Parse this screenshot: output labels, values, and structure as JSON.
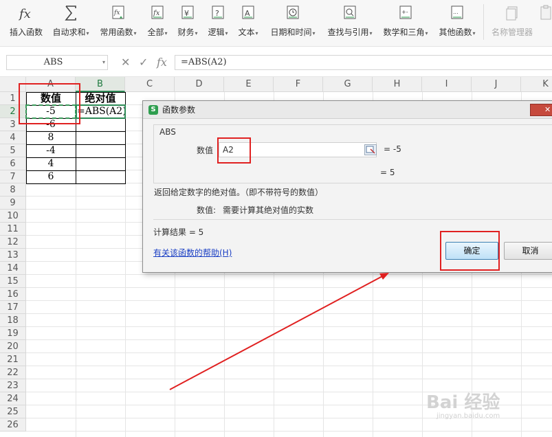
{
  "ribbon": {
    "buttons": [
      {
        "label": "插入函数",
        "icon": "fx-icon",
        "caret": false
      },
      {
        "label": "自动求和",
        "icon": "sigma-icon",
        "caret": true
      },
      {
        "label": "常用函数",
        "icon": "star-function-icon",
        "caret": true
      },
      {
        "label": "全部",
        "icon": "fx-box-icon",
        "caret": true
      },
      {
        "label": "财务",
        "icon": "yen-icon",
        "caret": true
      },
      {
        "label": "逻辑",
        "icon": "question-icon",
        "caret": true
      },
      {
        "label": "文本",
        "icon": "text-a-icon",
        "caret": true
      },
      {
        "label": "日期和时间",
        "icon": "clock-icon",
        "caret": true
      },
      {
        "label": "查找与引用",
        "icon": "lookup-icon",
        "caret": true
      },
      {
        "label": "数学和三角",
        "icon": "math-icon",
        "caret": true
      },
      {
        "label": "其他函数",
        "icon": "more-functions-icon",
        "caret": true
      },
      {
        "label": "名称管理器",
        "icon": "name-manager-icon",
        "caret": false
      }
    ],
    "caret_glyph": "▾"
  },
  "formula_bar": {
    "name_box": "ABS",
    "name_box_caret": "▾",
    "cancel_glyph": "✕",
    "confirm_glyph": "✓",
    "fx_glyph": "fx",
    "formula": "=ABS(A2)"
  },
  "grid": {
    "columns": [
      "A",
      "B",
      "C",
      "D",
      "E",
      "F",
      "G",
      "H",
      "I",
      "J",
      "K"
    ],
    "rows": [
      "1",
      "2",
      "3",
      "4",
      "5",
      "6",
      "7",
      "8",
      "9",
      "10",
      "11",
      "12",
      "13",
      "14",
      "15",
      "16",
      "17",
      "18",
      "19",
      "20",
      "21",
      "22",
      "23",
      "24",
      "25",
      "26"
    ],
    "active_column": "B",
    "active_row": "2",
    "headers": {
      "a1": "数值",
      "b1": "绝对值"
    },
    "a_values": [
      "-5",
      "-6",
      "8",
      "-4",
      "4",
      "6"
    ],
    "b2": "=ABS(A2)"
  },
  "dialog": {
    "title": "函数参数",
    "app_badge": "S",
    "close_glyph": "✕",
    "function_name": "ABS",
    "arg_label": "数值",
    "arg_value": "A2",
    "arg_eval": "= -5",
    "result_eval": "= 5",
    "description": "返回给定数字的绝对值。（即不带符号的数值）",
    "arg_desc_label": "数值:",
    "arg_desc_text": "需要计算其绝对值的实数",
    "calc_result": "计算结果 = 5",
    "help_link": "有关该函数的帮助(H)",
    "ok": "确定",
    "cancel": "取消"
  },
  "watermark": {
    "main": "Bai 经验",
    "sub": "jingyan.baidu.com"
  },
  "colors": {
    "annotation": "#e02020",
    "accent_green": "#2e8b57",
    "ok_blue": "#bfe1f7"
  }
}
